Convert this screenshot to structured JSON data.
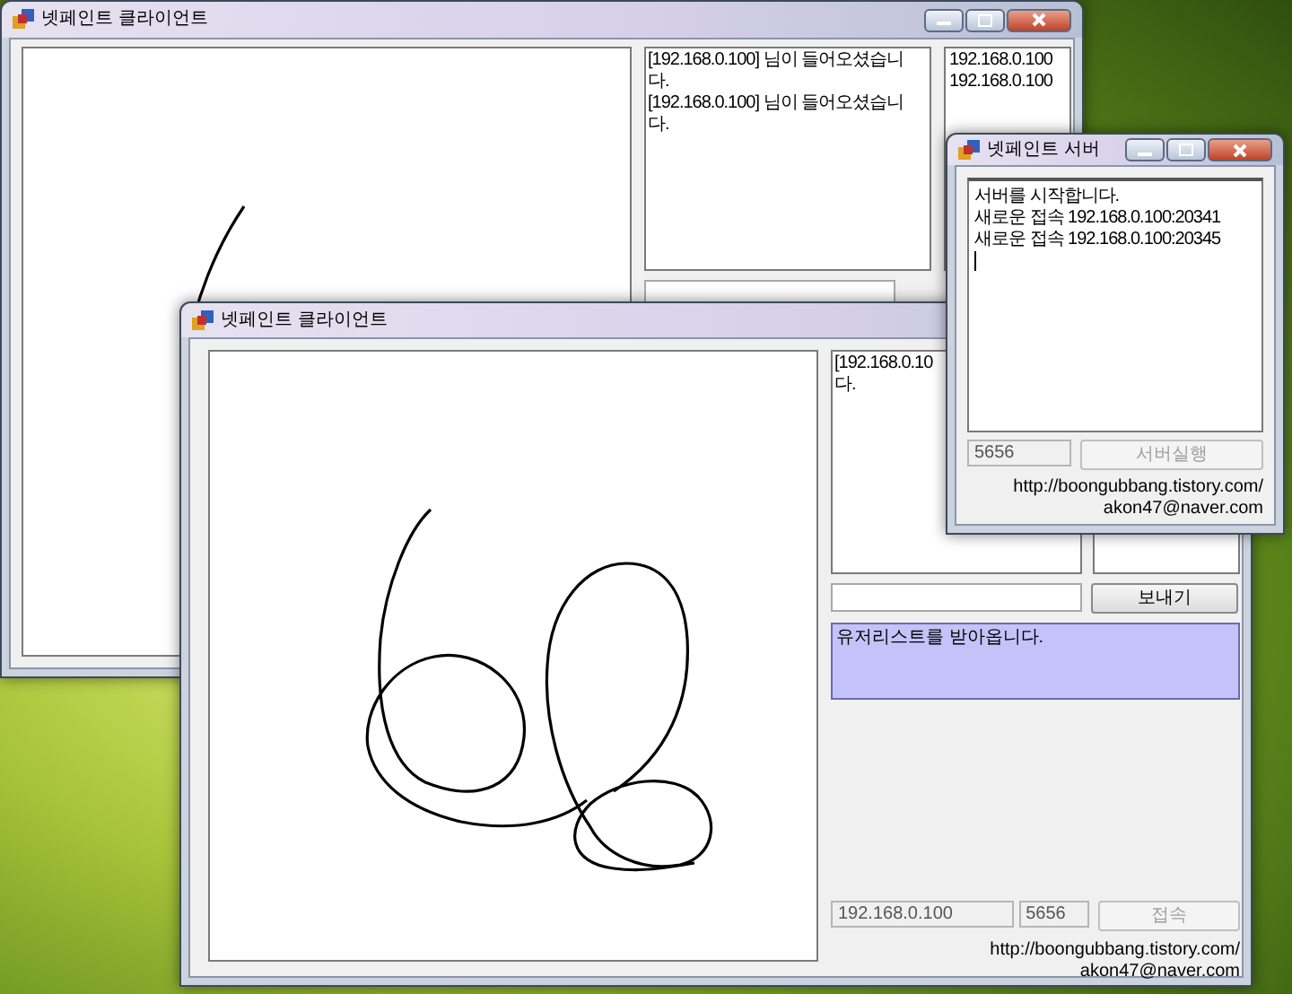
{
  "back_client": {
    "title": "넷페인트 클라이언트",
    "chat_lines": [
      "[192.168.0.100] 님이 들어오셨습니",
      "다.",
      "[192.168.0.100] 님이 들어오셨습니",
      "다."
    ],
    "users": [
      "192.168.0.100",
      "192.168.0.100"
    ]
  },
  "front_client": {
    "title": "넷페인트 클라이언트",
    "chat_lines": [
      "[192.168.0.10",
      "다."
    ],
    "send_button": "보내기",
    "status": "유저리스트를 받아옵니다.",
    "ip": "192.168.0.100",
    "port": "5656",
    "connect_button": {
      "label": "접속",
      "disabled": true
    },
    "links": [
      "http://boongubbang.tistory.com/",
      "akon47@naver.com"
    ]
  },
  "server": {
    "title": "넷페인트 서버",
    "log_lines": [
      "서버를 시작합니다.",
      "새로운 접속 192.168.0.100:20341",
      "새로운 접속 192.168.0.100:20345"
    ],
    "port": "5656",
    "port_disabled": true,
    "start_button": {
      "label": "서버실행",
      "disabled": true
    },
    "links": [
      "http://boongubbang.tistory.com/",
      "akon47@naver.com"
    ]
  }
}
